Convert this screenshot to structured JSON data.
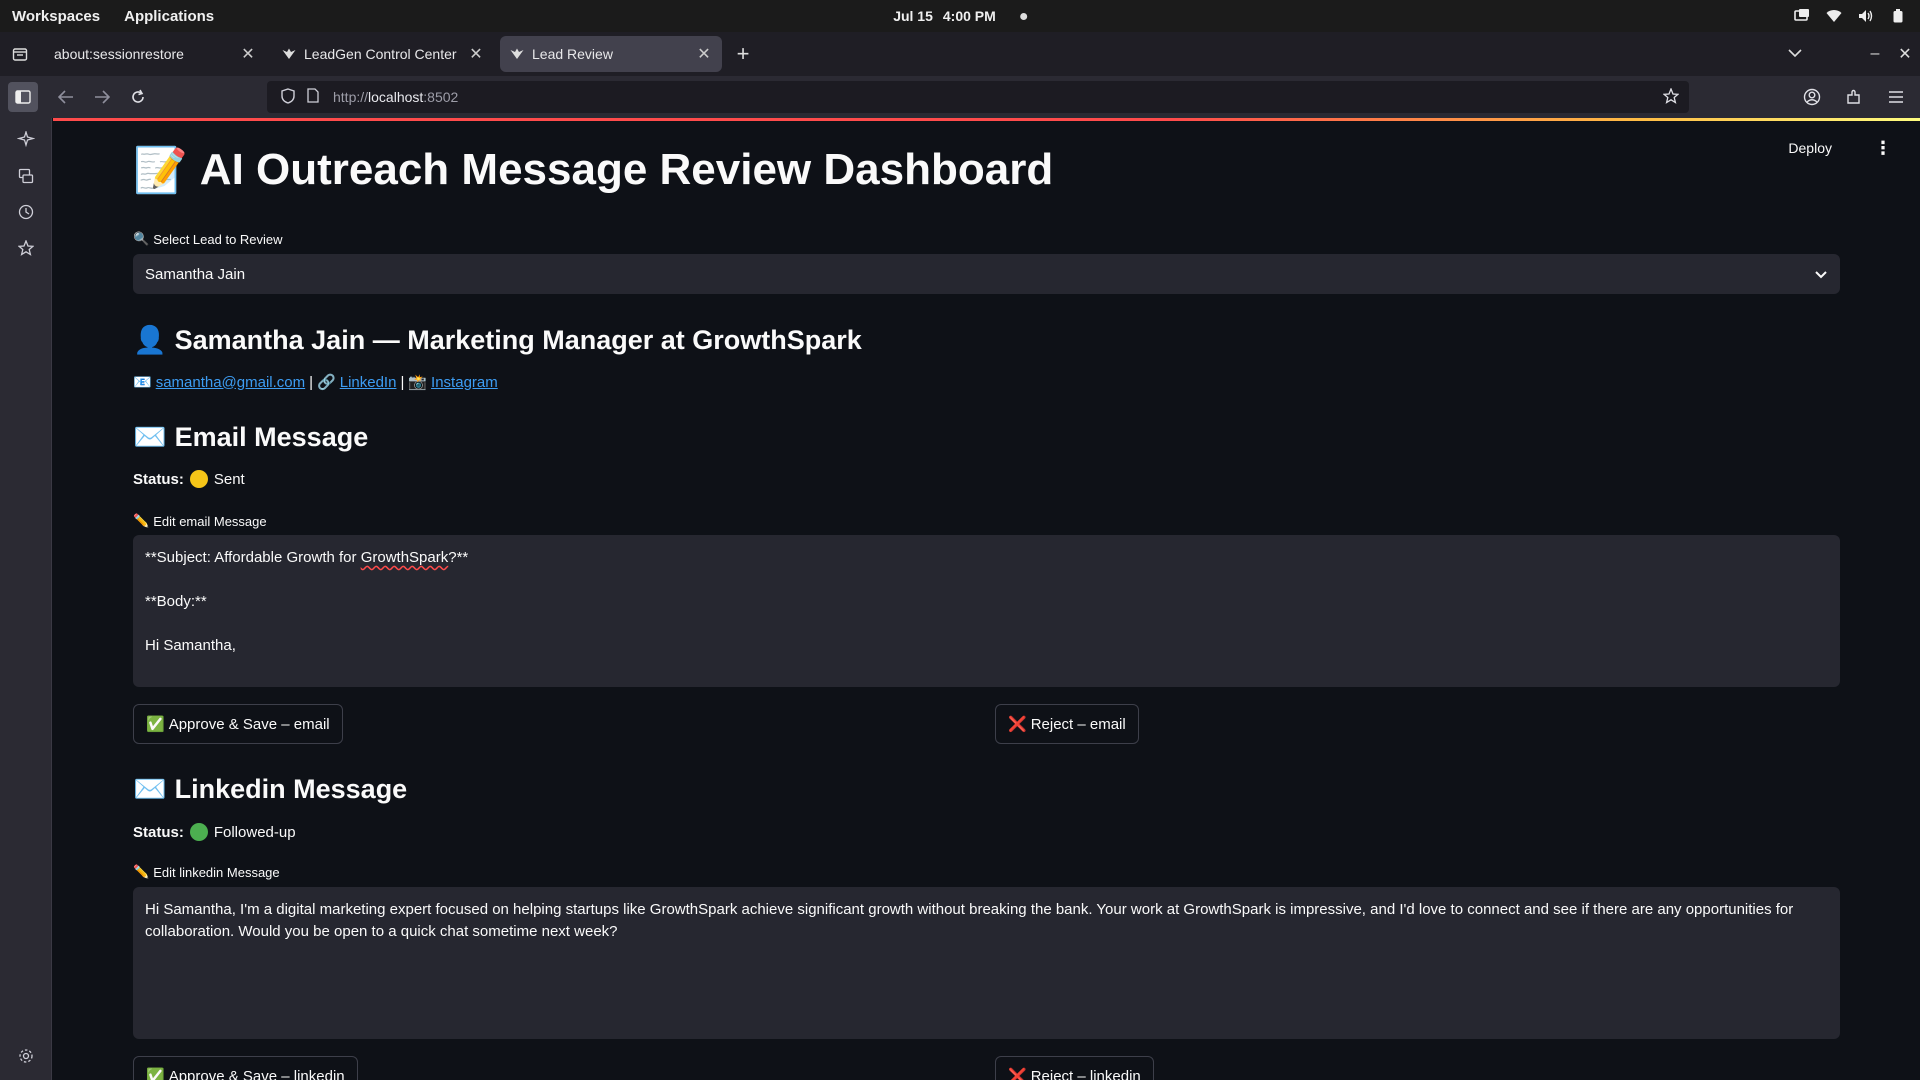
{
  "topbar": {
    "workspaces": "Workspaces",
    "applications": "Applications",
    "date": "Jul 15",
    "time": "4:00 PM"
  },
  "tabs": [
    {
      "label": "about:sessionrestore",
      "active": false
    },
    {
      "label": "LeadGen Control Center",
      "active": false
    },
    {
      "label": "Lead Review",
      "active": true
    }
  ],
  "navbar": {
    "url_prefix": "http://",
    "url_host": "localhost",
    "url_port": ":8502"
  },
  "header": {
    "deploy": "Deploy"
  },
  "main": {
    "title_emoji": "📝",
    "title": "AI Outreach Message Review Dashboard",
    "select_label": "Select Lead to Review",
    "selected_lead": "Samantha Jain",
    "lead_heading": "Samantha Jain — Marketing Manager at GrowthSpark",
    "contacts": {
      "email": "samantha@gmail.com",
      "sep1": "|",
      "linkedin": "LinkedIn",
      "sep2": "|",
      "instagram": "Instagram"
    },
    "email_section": {
      "heading": "Email Message",
      "status_label": "Status:",
      "status_value": "Sent",
      "status_color": "#f5c518",
      "edit_label": "Edit email Message",
      "message_line1": "**Subject: Affordable Growth for ",
      "message_word": "GrowthSpark",
      "message_line1_end": "?**",
      "message_line2": "**Body:**",
      "message_line3": "Hi Samantha,",
      "approve": "Approve & Save – email",
      "reject": "Reject – email"
    },
    "linkedin_section": {
      "heading": "Linkedin Message",
      "status_label": "Status:",
      "status_value": "Followed-up",
      "status_color": "#4caf50",
      "edit_label": "Edit linkedin Message",
      "message": "Hi Samantha, I'm a digital marketing expert focused on helping startups like GrowthSpark achieve significant growth without breaking the bank. Your work at GrowthSpark is impressive, and I'd love to connect and see if there are any opportunities for collaboration. Would you be open to a quick chat sometime next week?",
      "approve": "Approve & Save – linkedin",
      "reject": "Reject – linkedin"
    }
  }
}
